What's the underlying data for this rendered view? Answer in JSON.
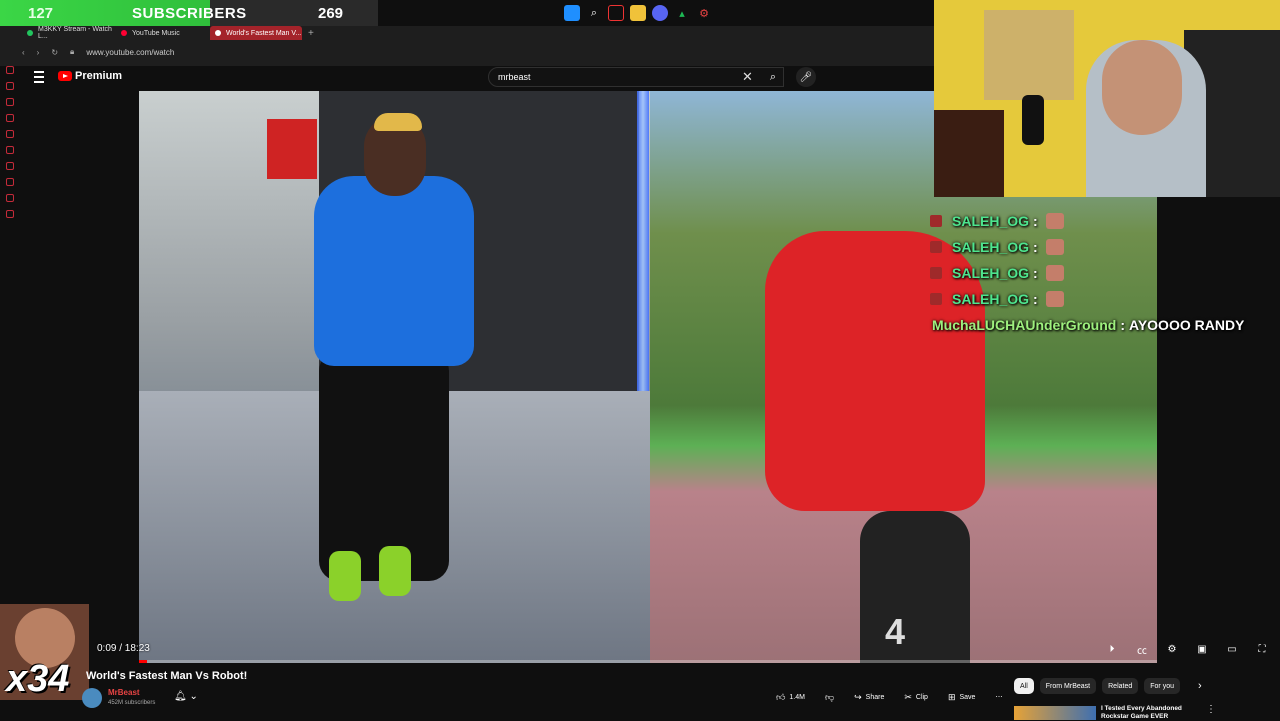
{
  "overlay": {
    "subscribers_left": "127",
    "subscribers_label": "SUBSCRIBERS",
    "subscribers_right": "269",
    "emote_multiplier": "x34"
  },
  "browser": {
    "tabs": [
      {
        "label": "M3KKY Stream - Watch L...",
        "color": "#22c55e"
      },
      {
        "label": "YouTube Music",
        "color": "#ff0033"
      },
      {
        "label": "World's Fastest Man V...",
        "color": "#ff0033",
        "active": true
      }
    ],
    "url": "www.youtube.com/watch"
  },
  "youtube": {
    "logo_label": "Premium",
    "search_query": "mrbeast",
    "video": {
      "time": "0:09 / 18:23",
      "progress": 0.008,
      "title": "World's Fastest Man Vs Robot!",
      "channel": "MrBeast",
      "subscribers": "452M subscribers",
      "jersey_number": "4"
    },
    "actions": {
      "likes": "1.4M",
      "share": "Share",
      "clip": "Clip",
      "save": "Save"
    },
    "chips": [
      "All",
      "From MrBeast",
      "Related",
      "For you"
    ],
    "recommendation": {
      "title": "I Tested Every Abandoned Rockstar Game EVER"
    }
  },
  "chat": {
    "lines": [
      {
        "user": "SALEH_OG"
      },
      {
        "user": "SALEH_OG"
      },
      {
        "user": "SALEH_OG"
      },
      {
        "user": "SALEH_OG"
      }
    ],
    "message": {
      "user": "MuchaLUCHAUnderGround",
      "text": "AYOOOO RANDY"
    }
  }
}
